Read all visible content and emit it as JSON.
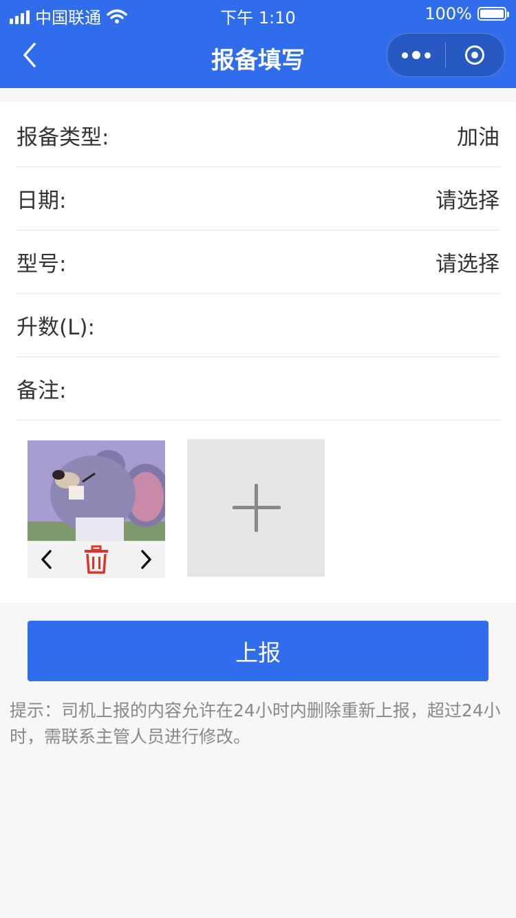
{
  "status_bar": {
    "carrier": "中国联通",
    "time": "下午 1:10",
    "battery": "100%"
  },
  "nav": {
    "title": "报备填写"
  },
  "form": {
    "fields": [
      {
        "label": "报备类型:",
        "value": "加油"
      },
      {
        "label": "日期:",
        "value": "请选择"
      },
      {
        "label": "型号:",
        "value": "请选择"
      },
      {
        "label": "升数(L):",
        "value": ""
      },
      {
        "label": "备注:",
        "value": ""
      }
    ]
  },
  "photos": {
    "uploaded_count": 1
  },
  "submit_label": "上报",
  "tip": "提示：司机上报的内容允许在24小时内删除重新上报，超过24小时，需联系主管人员进行修改。",
  "colors": {
    "primary": "#2f6ded",
    "delete_icon": "#d9362b",
    "page_bg": "#f7f7f7"
  }
}
